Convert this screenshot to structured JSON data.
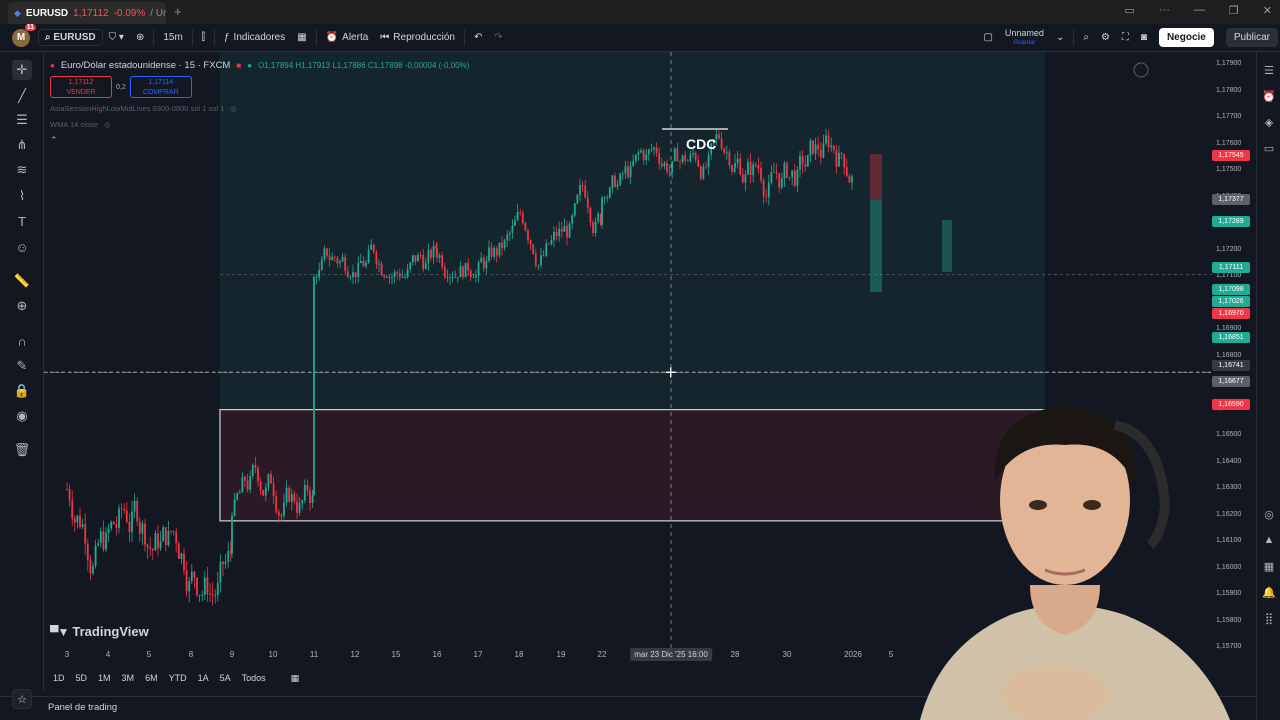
{
  "browser": {
    "tab_symbol": "EURUSD",
    "tab_price": "1,17112",
    "tab_change": "-0.09%",
    "tab_rest": "/ Un",
    "new_tab": "+"
  },
  "toolbar": {
    "avatar_letter": "M",
    "avatar_badge": "11",
    "symbol": "EURUSD",
    "interval": "15m",
    "indicators": "Indicadores",
    "alert": "Alerta",
    "replay": "Reproducción",
    "layout_name": "Unnamed",
    "layout_status": "Guardar",
    "trade_button": "Negocie",
    "publish_button": "Publicar"
  },
  "legend": {
    "title": "Euro/Dólar estadounidense · 15 · FXCM",
    "ohlc": "O1,17894 H1,17913 L1,17886 C1,17898 -0,00004 (-0,00%)",
    "sell_price": "1,17112",
    "sell_label": "VENDER",
    "spread": "0,2",
    "buy_price": "1,17114",
    "buy_label": "COMPRAR",
    "indicator1": "AsiaSessionHighLowMidLines 0300-0800 sol 1 sol 1",
    "indicator2": "WMA 14 close"
  },
  "annotation": {
    "cdc": "CDC"
  },
  "price_axis": {
    "ticks": [
      "1,17900",
      "1,17800",
      "1,17700",
      "1,17600",
      "1,17500",
      "1,17400",
      "1,17300",
      "1,17200",
      "1,17100",
      "1,17000",
      "1,16900",
      "1,16800",
      "1,16700",
      "1,16600",
      "1,16500",
      "1,16400",
      "1,16300",
      "1,16200",
      "1,16100",
      "1,16000",
      "1,15900",
      "1,15800",
      "1,15700"
    ],
    "labels": [
      {
        "text": "1,17545",
        "color": "#f23645"
      },
      {
        "text": "1,17377",
        "color": "#5d606b"
      },
      {
        "text": "1,17289",
        "color": "#22ab94"
      },
      {
        "text": "1,17111",
        "color": "#22ab94"
      },
      {
        "text": "1,17098",
        "color": "#22ab94"
      },
      {
        "text": "1,17026",
        "color": "#22ab94"
      },
      {
        "text": "1,16970",
        "color": "#f23645"
      },
      {
        "text": "1,16851",
        "color": "#22ab94"
      },
      {
        "text": "1,16741",
        "color": "#363a45"
      },
      {
        "text": "1,16677",
        "color": "#5d606b"
      },
      {
        "text": "1,16590",
        "color": "#f23645"
      }
    ]
  },
  "time_axis": {
    "ticks": [
      "3",
      "4",
      "5",
      "8",
      "9",
      "10",
      "11",
      "12",
      "15",
      "16",
      "17",
      "18",
      "19",
      "22",
      "28",
      "30",
      "2026",
      "5"
    ],
    "crosshair_label": "mar 23 Dic '25   16:00"
  },
  "ranges": [
    "1D",
    "5D",
    "1M",
    "3M",
    "6M",
    "YTD",
    "1A",
    "5A",
    "Todos"
  ],
  "bottom_panel": {
    "label": "Panel de trading"
  },
  "branding": {
    "logo_text": "TradingView"
  },
  "chart_data": {
    "type": "candlestick",
    "symbol": "EURUSD",
    "timeframe": "15",
    "ylim": [
      1.157,
      1.1795
    ],
    "x": [
      "3",
      "4",
      "5",
      "8",
      "9",
      "10",
      "11",
      "12",
      "15",
      "16",
      "17",
      "18",
      "19",
      "22",
      "23",
      "28",
      "30",
      "2026",
      "5"
    ],
    "segments": [
      {
        "from": "3",
        "to": "9",
        "low": 1.159,
        "high": 1.168
      },
      {
        "from": "9",
        "to": "11",
        "low": 1.162,
        "high": 1.169
      },
      {
        "from": "11",
        "to": "16",
        "low": 1.171,
        "high": 1.177
      },
      {
        "from": "16",
        "to": "22",
        "low": 1.171,
        "high": 1.177
      },
      {
        "from": "22",
        "to": "28",
        "low": 1.174,
        "high": 1.1795
      },
      {
        "from": "28",
        "to": "2026",
        "low": 1.171,
        "high": 1.178
      },
      {
        "from": "2026",
        "to": "5",
        "low": 1.1659,
        "high": 1.174
      }
    ],
    "zones": [
      {
        "kind": "demand",
        "low": 1.1618,
        "high": 1.166
      },
      {
        "kind": "range",
        "low": 1.166,
        "high": 1.1795
      }
    ],
    "horizontal_levels": [
      1.1711,
      1.16741
    ],
    "last_price": 1.17111,
    "annotations": [
      "CDC"
    ]
  }
}
